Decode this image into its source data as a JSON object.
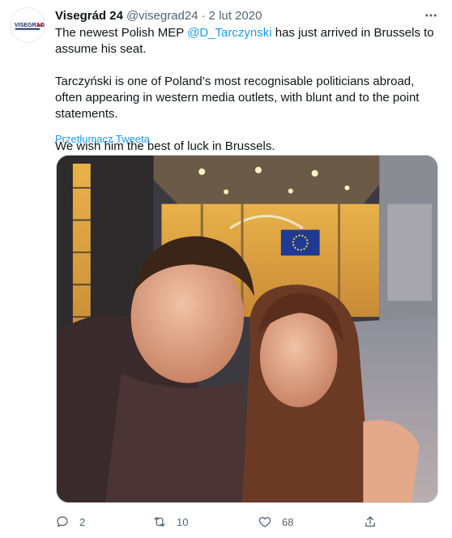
{
  "tweet": {
    "avatar_icon": "visegrad24-logo",
    "author_name": "Visegrád 24",
    "author_handle": "@visegrad24",
    "separator": "·",
    "date": "2 lut 2020",
    "more_icon": "more-icon",
    "text": {
      "line1_prefix": "The newest Polish MEP ",
      "mention": "@D_Tarczynski",
      "line1_suffix": " has just arrived in Brussels to assume his seat.",
      "paragraph2": "Tarczyński is one of Poland’s most recognisable politicians abroad, often appearing in western media outlets, with blunt and to the point statements.",
      "paragraph3": "We wish him the best of luck in Brussels."
    },
    "translate_label": "Przetłumacz Tweeta",
    "photo_icon": "selfie-photo",
    "actions": {
      "reply": {
        "icon": "reply-icon",
        "count": "2"
      },
      "retweet": {
        "icon": "retweet-icon",
        "count": "10"
      },
      "like": {
        "icon": "like-icon",
        "count": "68"
      },
      "share": {
        "icon": "share-icon"
      }
    },
    "colors": {
      "link": "#1d9bf0",
      "secondary_text": "#536471",
      "primary_text": "#0f1419"
    }
  }
}
